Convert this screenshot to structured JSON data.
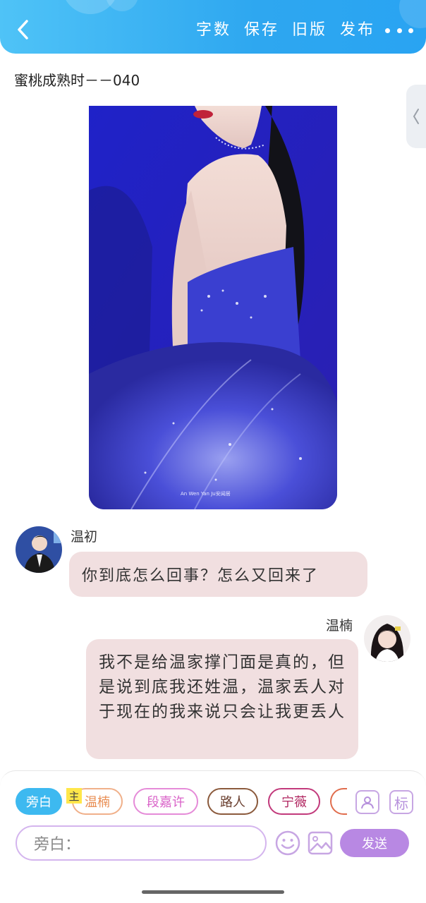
{
  "header": {
    "actions": [
      "字数",
      "保存",
      "旧版",
      "发布"
    ],
    "back_icon": "chevron-left-icon",
    "more_icon": "more-icon",
    "color": "#2ea7f0"
  },
  "story": {
    "title": "蜜桃成熟时－－040"
  },
  "image": {
    "watermark": "An Wen Yan Ju安闻居"
  },
  "messages": [
    {
      "speaker": "温初",
      "side": "left",
      "text": "你到底怎么回事？怎么又回来了"
    },
    {
      "speaker": "温楠",
      "side": "right",
      "text": "我不是给温家撑门面是真的，但是说到底我还姓温，温家丢人对于现在的我来说只会让我更丢人"
    }
  ],
  "composer": {
    "roles": [
      {
        "label": "旁白",
        "active": true
      },
      {
        "label": "温楠",
        "badge": "主"
      },
      {
        "label": "段嘉许"
      },
      {
        "label": "路人"
      },
      {
        "label": "宁薇"
      }
    ],
    "tools": [
      "role-manage-icon",
      "标"
    ],
    "input_placeholder": "旁白：",
    "send_label": "发送"
  }
}
